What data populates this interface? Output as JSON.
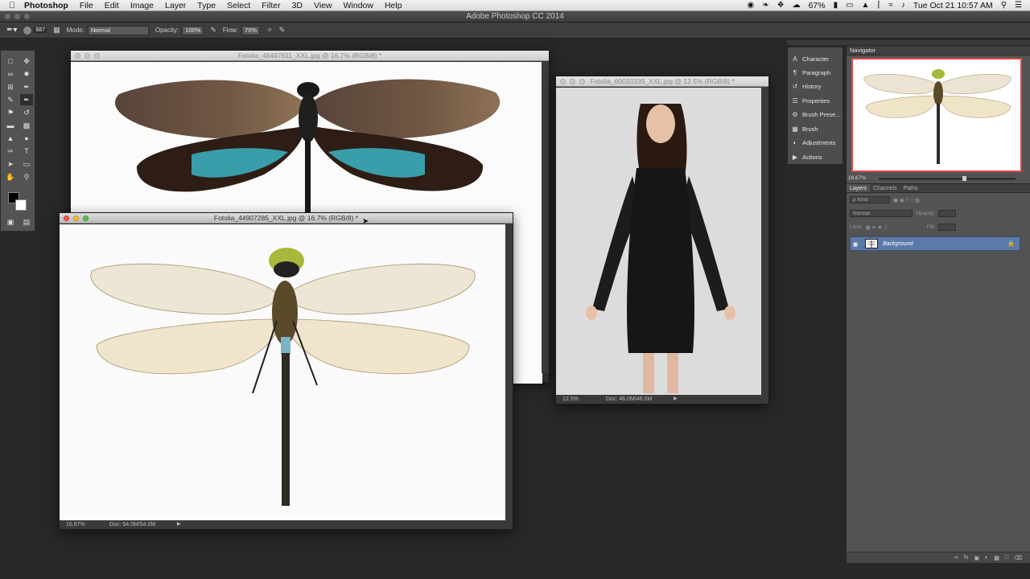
{
  "menubar": {
    "app": "Photoshop",
    "menus": [
      "File",
      "Edit",
      "Image",
      "Layer",
      "Type",
      "Select",
      "Filter",
      "3D",
      "View",
      "Window",
      "Help"
    ],
    "battery": "67%",
    "clock": "Tue Oct 21  10:57 AM"
  },
  "appbar": {
    "title": "Adobe Photoshop CC 2014"
  },
  "options": {
    "brush_size": "687",
    "mode_label": "Mode:",
    "mode_value": "Normal",
    "opacity_label": "Opacity:",
    "opacity_value": "100%",
    "flow_label": "Flow:",
    "flow_value": "70%"
  },
  "documents": [
    {
      "title": "Fotolia_46467611_XXL.jpg @ 16.7% (RGB/8) *"
    },
    {
      "title": "Fotolia_60033339_XXL.jpg @ 12.5% (RGB/8) *",
      "zoom": "12.5%",
      "docsize": "Doc: 46.0M/46.0M"
    },
    {
      "title": "Fotolia_44907285_XXL.jpg @ 16.7% (RGB/8) *",
      "zoom": "16.67%",
      "docsize": "Doc: 54.0M/54.0M"
    }
  ],
  "dock": {
    "items": [
      "Character",
      "Paragraph",
      "History",
      "Properties",
      "Brush Prese...",
      "Brush",
      "Adjustments",
      "Actions"
    ]
  },
  "navigator": {
    "title": "Navigator",
    "zoom": "16.67%"
  },
  "layers": {
    "tabs": [
      "Layers",
      "Channels",
      "Paths"
    ],
    "kind": "ρ Kind",
    "blend": "Normal",
    "opacity_label": "Opacity:",
    "lock_label": "Lock:",
    "fill_label": "Fill:",
    "layer_name": "Background"
  }
}
